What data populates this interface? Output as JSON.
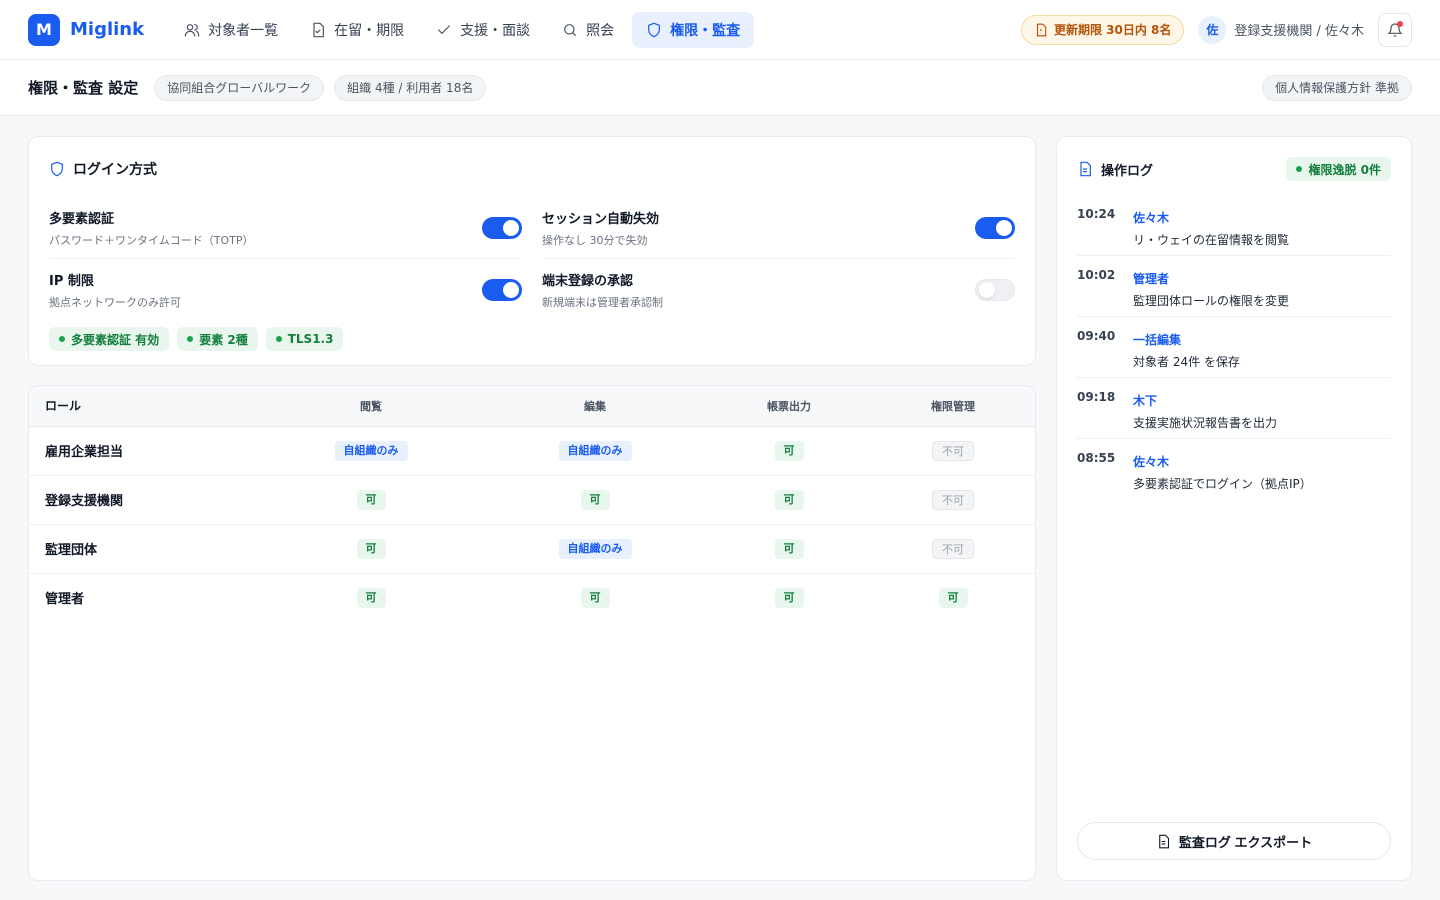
{
  "app": {
    "logo_letter": "M",
    "name": "Miglink"
  },
  "nav": {
    "items": [
      {
        "label": "対象者一覧",
        "icon": "users-icon"
      },
      {
        "label": "在留・期限",
        "icon": "document-icon"
      },
      {
        "label": "支援・面談",
        "icon": "check-icon"
      },
      {
        "label": "照会",
        "icon": "search-icon"
      },
      {
        "label": "権限・監査",
        "icon": "shield-icon",
        "active": true
      }
    ],
    "renew_badge": "更新期限 30日内 8名",
    "user_avatar": "佐",
    "user_label": "登録支援機関 / 佐々木"
  },
  "subheader": {
    "title": "権限・監査 設定",
    "chips": [
      "協同組合グローバルワーク",
      "組織 4種 / 利用者 18名"
    ],
    "policy_chip": "個人情報保護方針 準拠"
  },
  "login": {
    "title": "ログイン方式",
    "settings": [
      {
        "name": "多要素認証",
        "desc": "パスワード＋ワンタイムコード（TOTP）",
        "enabled": true
      },
      {
        "name": "セッション自動失効",
        "desc": "操作なし 30分で失効",
        "enabled": true
      },
      {
        "name": "IP 制限",
        "desc": "拠点ネットワークのみ許可",
        "enabled": true
      },
      {
        "name": "端末登録の承認",
        "desc": "新規端末は管理者承認制",
        "enabled": false
      }
    ],
    "tags": [
      "多要素認証 有効",
      "要素 2種",
      "TLS1.3"
    ]
  },
  "roles": {
    "headers": [
      "ロール",
      "閲覧",
      "編集",
      "帳票出力",
      "権限管理"
    ],
    "rows": [
      {
        "role": "雇用企業担当",
        "perms": [
          "自組織のみ",
          "自組織のみ",
          "可",
          "不可"
        ]
      },
      {
        "role": "登録支援機関",
        "perms": [
          "可",
          "可",
          "可",
          "不可"
        ]
      },
      {
        "role": "監理団体",
        "perms": [
          "可",
          "自組織のみ",
          "可",
          "不可"
        ]
      },
      {
        "role": "管理者",
        "perms": [
          "可",
          "可",
          "可",
          "可"
        ]
      }
    ]
  },
  "log": {
    "title": "操作ログ",
    "badge": "権限逸脱 0件",
    "entries": [
      {
        "time": "10:24",
        "actor": "佐々木",
        "action": "リ・ウェイの在留情報を閲覧"
      },
      {
        "time": "10:02",
        "actor": "管理者",
        "action": "監理団体ロールの権限を変更"
      },
      {
        "time": "09:40",
        "actor": "一括編集",
        "action": "対象者 24件 を保存"
      },
      {
        "time": "09:18",
        "actor": "木下",
        "action": "支援実施状況報告書を出力"
      },
      {
        "time": "08:55",
        "actor": "佐々木",
        "action": "多要素認証でログイン（拠点IP）"
      }
    ],
    "export_label": "監査ログ エクスポート"
  },
  "colors": {
    "accent": "#1a5cf0",
    "ok": "#15803d",
    "warn": "#b45309"
  }
}
